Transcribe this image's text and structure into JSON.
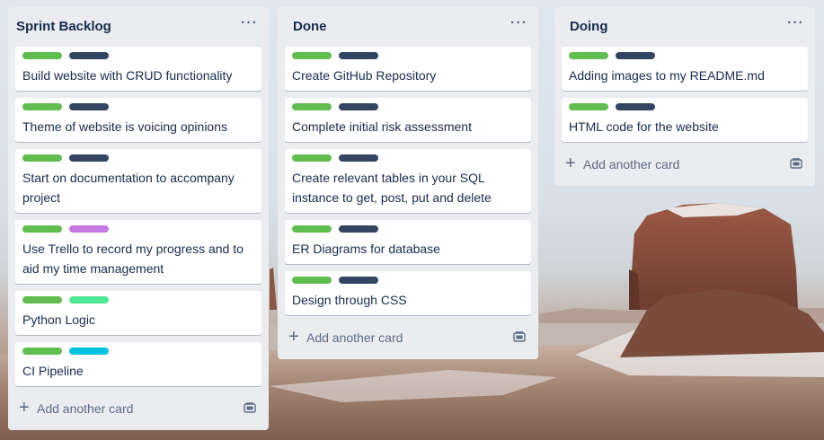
{
  "board": {
    "lists": [
      {
        "title": "Sprint Backlog",
        "menu_icon": "more-icon",
        "add_card_label": "Add another card",
        "cards": [
          {
            "title": "Build website with CRUD functionality",
            "labels": [
              "#61bd4f",
              "#344563"
            ]
          },
          {
            "title": "Theme of website is voicing opinions",
            "labels": [
              "#61bd4f",
              "#344563"
            ]
          },
          {
            "title": "Start on documentation to accompany project",
            "labels": [
              "#61bd4f",
              "#344563"
            ]
          },
          {
            "title": "Use Trello to record my progress and to aid my time management",
            "labels": [
              "#61bd4f",
              "#c377e0"
            ]
          },
          {
            "title": "Python Logic",
            "labels": [
              "#61bd4f",
              "#51e898"
            ]
          },
          {
            "title": "CI Pipeline",
            "labels": [
              "#61bd4f",
              "#00c2e0"
            ]
          }
        ]
      },
      {
        "title": "Done",
        "menu_icon": "more-icon",
        "add_card_label": "Add another card",
        "cards": [
          {
            "title": "Create GitHub Repository",
            "labels": [
              "#61bd4f",
              "#344563"
            ]
          },
          {
            "title": "Complete initial risk assessment",
            "labels": [
              "#61bd4f",
              "#344563"
            ]
          },
          {
            "title": "Create relevant tables in your SQL instance to get, post, put and delete",
            "labels": [
              "#61bd4f",
              "#344563"
            ]
          },
          {
            "title": "ER Diagrams for database",
            "labels": [
              "#61bd4f",
              "#344563"
            ]
          },
          {
            "title": "Design through CSS",
            "labels": [
              "#61bd4f",
              "#344563"
            ]
          }
        ]
      },
      {
        "title": "Doing",
        "menu_icon": "more-icon",
        "add_card_label": "Add another card",
        "cards": [
          {
            "title": "Adding images to my README.md",
            "labels": [
              "#61bd4f",
              "#344563"
            ]
          },
          {
            "title": "HTML code for the website",
            "labels": [
              "#61bd4f",
              "#344563"
            ]
          }
        ]
      }
    ]
  }
}
